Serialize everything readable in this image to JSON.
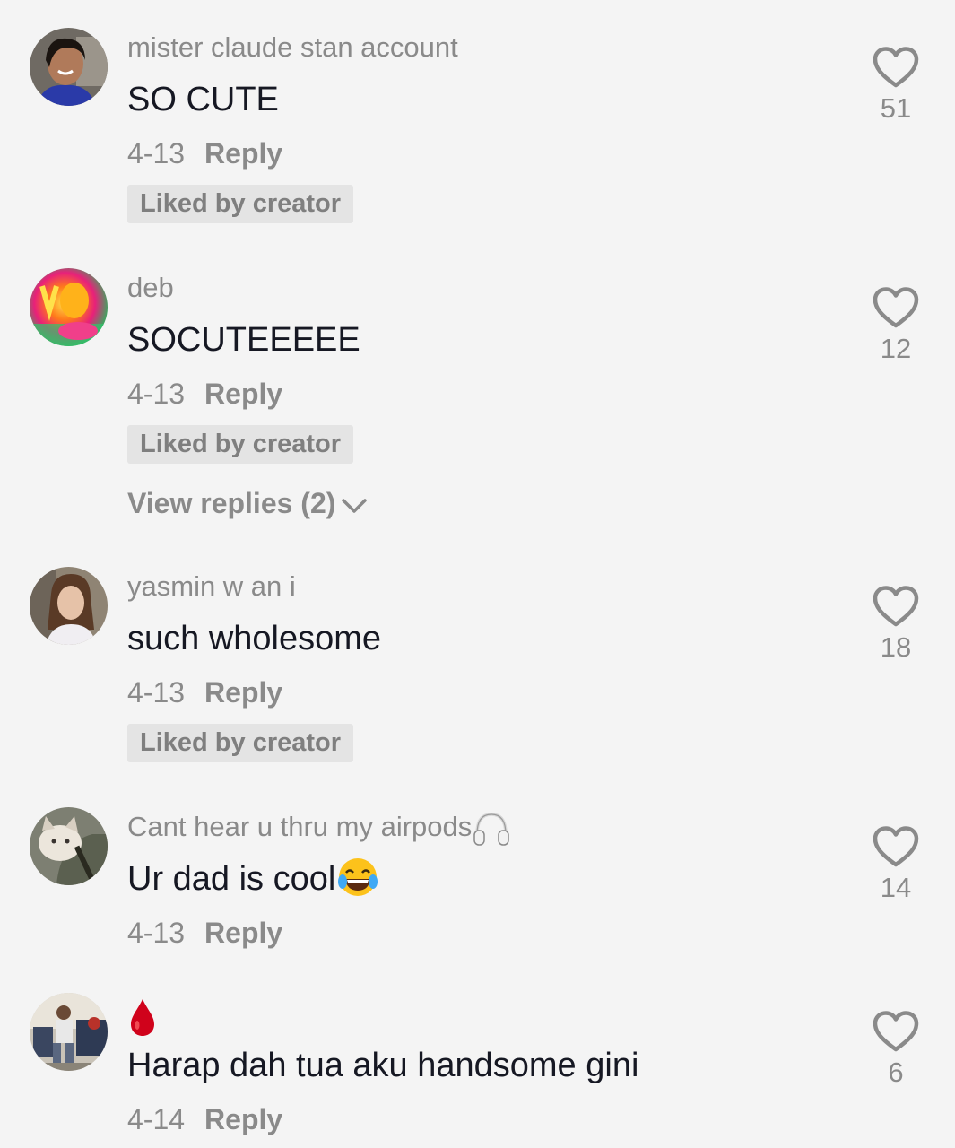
{
  "comments": [
    {
      "username": "mister claude stan account",
      "text": "SO CUTE",
      "date": "4-13",
      "reply_label": "Reply",
      "liked_badge": "Liked by creator",
      "likes": "51"
    },
    {
      "username": "deb",
      "text": "SOCUTEEEEE",
      "date": "4-13",
      "reply_label": "Reply",
      "liked_badge": "Liked by creator",
      "view_replies": "View replies (2)",
      "likes": "12"
    },
    {
      "username": "yasmin w an i",
      "text": "such wholesome",
      "date": "4-13",
      "reply_label": "Reply",
      "liked_badge": "Liked by creator",
      "likes": "18"
    },
    {
      "username": "Cant hear u thru my airpods",
      "username_emoji": "headphones-icon",
      "text": "Ur dad is cool",
      "text_emoji": "laughing-tears-emoji",
      "date": "4-13",
      "reply_label": "Reply",
      "likes": "14"
    },
    {
      "username_emoji": "blood-drop-icon",
      "text": "Harap dah tua aku handsome gini",
      "date": "4-14",
      "reply_label": "Reply",
      "likes": "6"
    }
  ],
  "colors": {
    "background": "#f4f4f4",
    "secondary_text": "#8a8a8a",
    "primary_text": "#161823",
    "badge_background": "#e4e4e4",
    "blood_drop": "#d0021b"
  }
}
